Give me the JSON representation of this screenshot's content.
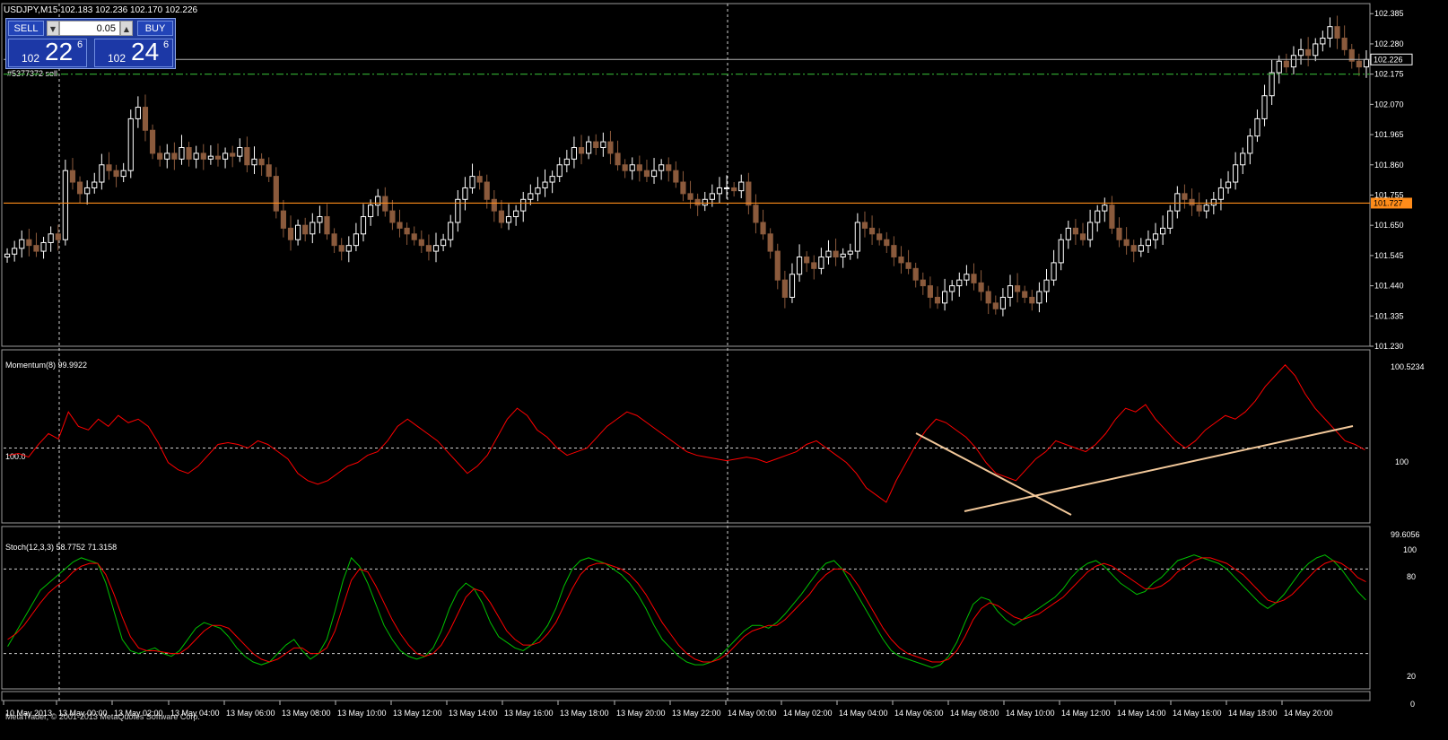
{
  "header": {
    "symbol_info": "USDJPY,M15  102.183 102.236 102.170 102.226"
  },
  "trade_panel": {
    "sell_label": "SELL",
    "buy_label": "BUY",
    "lot_value": "0.05",
    "sell_quote": {
      "prefix": "102",
      "big": "22",
      "sup": "6"
    },
    "buy_quote": {
      "prefix": "102",
      "big": "24",
      "sup": "6"
    }
  },
  "order_label": "#5377372 sell",
  "price_axis": {
    "ticks": [
      "102.385",
      "102.280",
      "102.175",
      "102.070",
      "101.965",
      "101.860",
      "101.755",
      "101.650",
      "101.545",
      "101.440",
      "101.335",
      "101.230"
    ],
    "current_price_label": "102.226",
    "horizontal_line_label": "101.727"
  },
  "momentum_panel": {
    "title": "Momentum(8) 99.9922",
    "level_label": "100.0",
    "axis_top": "100.5234",
    "axis_mid": "100",
    "axis_bottom": "99.6056"
  },
  "stoch_panel": {
    "title": "Stoch(12,3,3) 58.7752 71.3158",
    "axis": [
      "100",
      "80",
      "20",
      "0"
    ]
  },
  "time_axis": [
    "10 May 2013",
    "13 May 00:00",
    "13 May 02:00",
    "13 May 04:00",
    "13 May 06:00",
    "13 May 08:00",
    "13 May 10:00",
    "13 May 12:00",
    "13 May 14:00",
    "13 May 16:00",
    "13 May 18:00",
    "13 May 20:00",
    "13 May 22:00",
    "14 May 00:00",
    "14 May 02:00",
    "14 May 04:00",
    "14 May 06:00",
    "14 May 08:00",
    "14 May 10:00",
    "14 May 12:00",
    "14 May 14:00",
    "14 May 16:00",
    "14 May 18:00",
    "14 May 20:00"
  ],
  "footer_text": "MetaTrader, © 2001-2013 MetaQuotes Software Corp.",
  "colors": {
    "background": "#000000",
    "bull": "#ffffff",
    "bear": "#8b5a3c",
    "momentum": "#ff0000",
    "stoch_main": "#00c000",
    "stoch_signal": "#ff0000",
    "hline": "#ff8c1a",
    "sl_line": "#2e9e2e",
    "trendline": "#f2c89a"
  },
  "chart_data": [
    {
      "type": "candlestick",
      "title": "USDJPY,M15",
      "ylim": [
        101.23,
        102.42
      ],
      "horizontal_lines": [
        102.226,
        102.175,
        101.727
      ],
      "closes": [
        101.55,
        101.57,
        101.6,
        101.58,
        101.56,
        101.59,
        101.62,
        101.6,
        101.84,
        101.8,
        101.76,
        101.78,
        101.8,
        101.86,
        101.84,
        101.82,
        101.84,
        102.02,
        102.06,
        101.98,
        101.9,
        101.88,
        101.9,
        101.88,
        101.92,
        101.88,
        101.9,
        101.88,
        101.89,
        101.88,
        101.9,
        101.89,
        101.92,
        101.86,
        101.88,
        101.86,
        101.82,
        101.7,
        101.64,
        101.6,
        101.65,
        101.62,
        101.66,
        101.68,
        101.62,
        101.58,
        101.56,
        101.58,
        101.62,
        101.68,
        101.72,
        101.75,
        101.7,
        101.66,
        101.64,
        101.62,
        101.6,
        101.58,
        101.56,
        101.58,
        101.6,
        101.66,
        101.74,
        101.78,
        101.82,
        101.8,
        101.74,
        101.7,
        101.66,
        101.68,
        101.7,
        101.74,
        101.76,
        101.78,
        101.8,
        101.82,
        101.86,
        101.88,
        101.92,
        101.9,
        101.94,
        101.92,
        101.94,
        101.9,
        101.86,
        101.84,
        101.86,
        101.84,
        101.82,
        101.84,
        101.86,
        101.84,
        101.8,
        101.76,
        101.74,
        101.72,
        101.74,
        101.76,
        101.78,
        101.78,
        101.77,
        101.8,
        101.72,
        101.66,
        101.62,
        101.56,
        101.46,
        101.4,
        101.48,
        101.54,
        101.52,
        101.5,
        101.54,
        101.56,
        101.54,
        101.55,
        101.56,
        101.66,
        101.64,
        101.62,
        101.6,
        101.58,
        101.54,
        101.52,
        101.5,
        101.46,
        101.44,
        101.4,
        101.38,
        101.42,
        101.44,
        101.46,
        101.48,
        101.45,
        101.42,
        101.38,
        101.36,
        101.4,
        101.44,
        101.42,
        101.4,
        101.38,
        101.42,
        101.46,
        101.52,
        101.6,
        101.64,
        101.62,
        101.6,
        101.66,
        101.7,
        101.72,
        101.64,
        101.6,
        101.58,
        101.56,
        101.58,
        101.6,
        101.62,
        101.64,
        101.7,
        101.76,
        101.74,
        101.72,
        101.7,
        101.72,
        101.74,
        101.78,
        101.8,
        101.86,
        101.9,
        101.96,
        102.02,
        102.1,
        102.18,
        102.22,
        102.2,
        102.24,
        102.26,
        102.24,
        102.28,
        102.3,
        102.34,
        102.3,
        102.26,
        102.22,
        102.2,
        102.226
      ]
    },
    {
      "type": "line",
      "title": "Momentum(8)",
      "ylim": [
        99.6056,
        100.5234
      ],
      "reference_level": 100,
      "series": [
        {
          "values": [
            99.96,
            99.97,
            99.95,
            100.02,
            100.08,
            100.05,
            100.2,
            100.12,
            100.1,
            100.16,
            100.12,
            100.18,
            100.14,
            100.16,
            100.12,
            100.03,
            99.92,
            99.88,
            99.86,
            99.9,
            99.96,
            100.02,
            100.03,
            100.02,
            100.0,
            100.04,
            100.02,
            99.98,
            99.94,
            99.86,
            99.82,
            99.8,
            99.82,
            99.86,
            99.9,
            99.92,
            99.96,
            99.98,
            100.04,
            100.12,
            100.16,
            100.12,
            100.08,
            100.04,
            99.98,
            99.92,
            99.86,
            99.9,
            99.96,
            100.06,
            100.16,
            100.22,
            100.18,
            100.1,
            100.06,
            100.0,
            99.96,
            99.98,
            100.0,
            100.06,
            100.12,
            100.16,
            100.2,
            100.18,
            100.14,
            100.1,
            100.06,
            100.02,
            99.98,
            99.96,
            99.95,
            99.94,
            99.93,
            99.94,
            99.95,
            99.94,
            99.92,
            99.94,
            99.96,
            99.98,
            100.02,
            100.04,
            100.0,
            99.96,
            99.92,
            99.86,
            99.78,
            99.74,
            99.7,
            99.82,
            99.92,
            100.02,
            100.1,
            100.16,
            100.14,
            100.1,
            100.06,
            100.0,
            99.92,
            99.86,
            99.84,
            99.82,
            99.88,
            99.94,
            99.98,
            100.04,
            100.02,
            100.0,
            99.98,
            100.02,
            100.08,
            100.16,
            100.22,
            100.2,
            100.24,
            100.16,
            100.1,
            100.04,
            100.0,
            100.04,
            100.1,
            100.14,
            100.18,
            100.16,
            100.2,
            100.26,
            100.34,
            100.4,
            100.46,
            100.4,
            100.3,
            100.22,
            100.16,
            100.1,
            100.04,
            100.02,
            99.99
          ]
        }
      ]
    },
    {
      "type": "line",
      "title": "Stoch(12,3,3)",
      "ylim": [
        0,
        100
      ],
      "levels": [
        20,
        80
      ],
      "series": [
        {
          "name": "main",
          "values": [
            25,
            35,
            45,
            55,
            65,
            70,
            75,
            80,
            85,
            88,
            86,
            84,
            70,
            50,
            30,
            22,
            20,
            22,
            24,
            20,
            18,
            22,
            30,
            38,
            42,
            40,
            38,
            32,
            24,
            18,
            14,
            12,
            14,
            20,
            26,
            30,
            22,
            16,
            20,
            30,
            50,
            72,
            88,
            82,
            70,
            55,
            40,
            30,
            22,
            18,
            16,
            18,
            24,
            36,
            52,
            64,
            70,
            66,
            56,
            42,
            32,
            28,
            24,
            22,
            26,
            32,
            40,
            52,
            68,
            80,
            86,
            88,
            86,
            84,
            80,
            76,
            70,
            62,
            52,
            40,
            30,
            24,
            18,
            14,
            12,
            12,
            14,
            18,
            24,
            30,
            36,
            40,
            40,
            38,
            42,
            48,
            55,
            62,
            70,
            78,
            84,
            86,
            80,
            70,
            60,
            50,
            40,
            30,
            22,
            18,
            16,
            14,
            12,
            10,
            12,
            18,
            28,
            42,
            55,
            60,
            58,
            50,
            44,
            40,
            44,
            48,
            52,
            56,
            60,
            66,
            74,
            80,
            84,
            86,
            82,
            76,
            70,
            66,
            62,
            64,
            70,
            74,
            80,
            86,
            88,
            90,
            88,
            86,
            84,
            80,
            74,
            68,
            62,
            56,
            52,
            56,
            62,
            70,
            78,
            84,
            88,
            90,
            86,
            80,
            72,
            64,
            58
          ]
        },
        {
          "name": "signal",
          "values": [
            30,
            34,
            40,
            48,
            56,
            63,
            68,
            72,
            78,
            82,
            84,
            84,
            76,
            62,
            46,
            32,
            24,
            22,
            22,
            21,
            20,
            20,
            24,
            30,
            36,
            40,
            40,
            38,
            32,
            26,
            20,
            16,
            14,
            16,
            20,
            24,
            24,
            20,
            20,
            24,
            36,
            54,
            72,
            80,
            78,
            68,
            56,
            44,
            34,
            26,
            20,
            18,
            20,
            26,
            36,
            48,
            60,
            66,
            64,
            56,
            46,
            36,
            30,
            26,
            26,
            28,
            34,
            42,
            54,
            66,
            76,
            82,
            84,
            84,
            82,
            80,
            76,
            70,
            62,
            52,
            42,
            34,
            26,
            20,
            16,
            14,
            14,
            16,
            20,
            26,
            32,
            36,
            38,
            40,
            40,
            44,
            50,
            56,
            62,
            70,
            76,
            80,
            80,
            76,
            68,
            58,
            48,
            38,
            30,
            24,
            20,
            18,
            16,
            14,
            14,
            16,
            22,
            32,
            44,
            52,
            56,
            54,
            50,
            46,
            44,
            46,
            48,
            52,
            56,
            60,
            66,
            72,
            78,
            82,
            84,
            82,
            78,
            74,
            70,
            66,
            66,
            68,
            72,
            78,
            82,
            86,
            88,
            88,
            86,
            84,
            80,
            76,
            70,
            64,
            58,
            56,
            58,
            62,
            68,
            74,
            80,
            84,
            86,
            84,
            80,
            74,
            71
          ]
        }
      ]
    }
  ]
}
